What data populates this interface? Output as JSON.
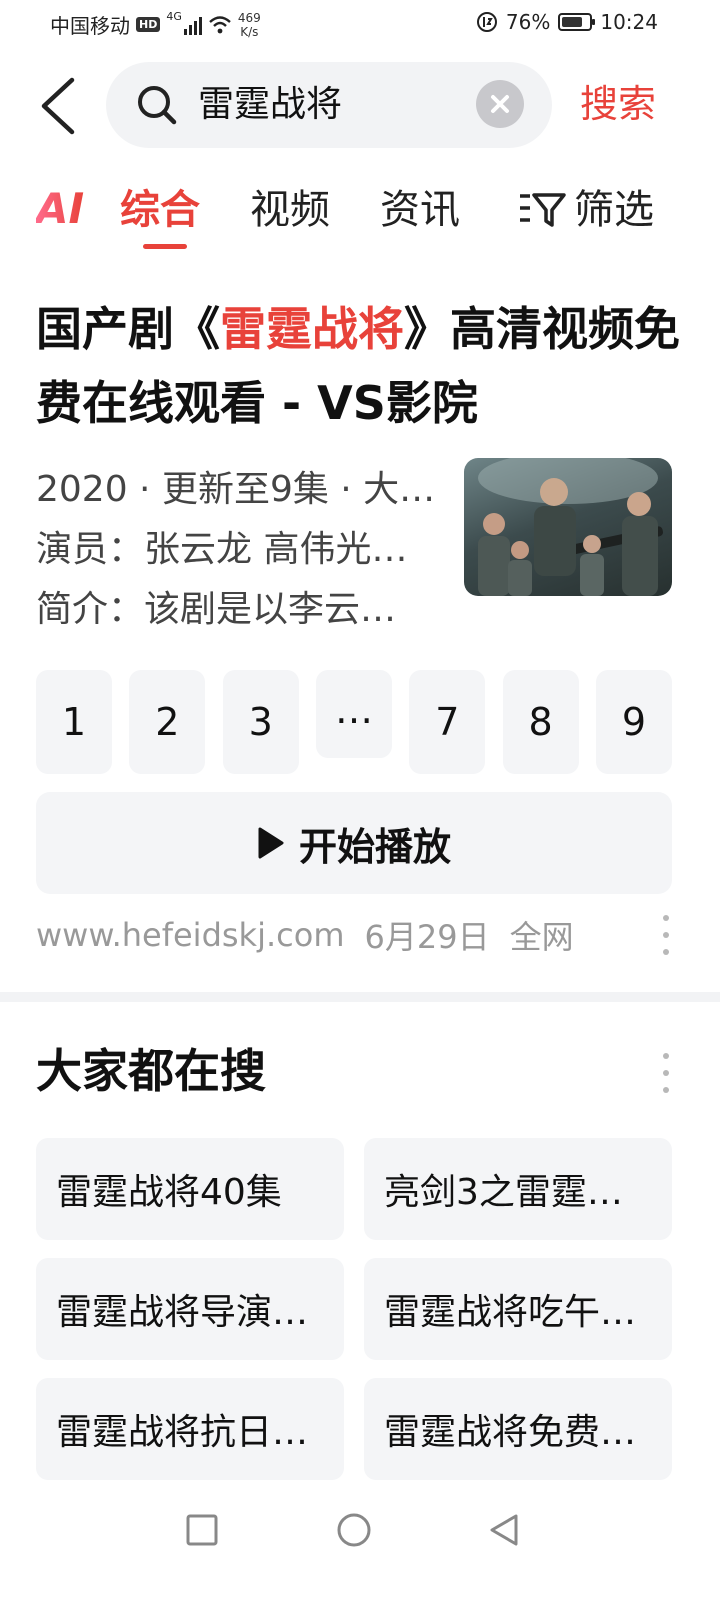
{
  "status_bar": {
    "carrier": "中国移动",
    "hd": "HD",
    "network": "4G",
    "net_speed_value": "469",
    "net_speed_unit": "K/s",
    "battery_percent": "76%",
    "battery_level": 0.76,
    "time": "10:24"
  },
  "search": {
    "query": "雷霆战将",
    "submit_label": "搜索"
  },
  "tabs": {
    "ai_label": "AI",
    "items": [
      "综合",
      "视频",
      "资讯"
    ],
    "active_index": 0,
    "filter_label": "筛选"
  },
  "result": {
    "title_prefix": "国产剧《",
    "title_highlight": "雷霆战将",
    "title_suffix": "》高清视频免费在线观看 - VS影院",
    "meta_line_1": "2020 · 更新至9集 · 大…",
    "meta_line_2": "演员：张云龙 高伟光…",
    "meta_line_3": "简介：该剧是以李云…",
    "episodes": [
      "1",
      "2",
      "3",
      "…",
      "7",
      "8",
      "9"
    ],
    "play_label": "开始播放",
    "source_url": "www.hefeidskj.com",
    "source_date": "6月29日",
    "source_scope": "全网"
  },
  "related": {
    "title": "大家都在搜",
    "items": [
      "雷霆战将40集",
      "亮剑3之雷霆…",
      "雷霆战将导演…",
      "雷霆战将吃午…",
      "雷霆战将抗日…",
      "雷霆战将免费…"
    ]
  },
  "colors": {
    "accent": "#e8423a",
    "card_bg": "#f4f5f7",
    "muted_text": "#999999"
  },
  "icons": {
    "back": "back-arrow-icon",
    "search": "search-icon",
    "clear": "clear-icon",
    "filter": "filter-icon",
    "play": "play-icon",
    "more": "more-vertical-icon",
    "nav_recent": "square-icon",
    "nav_home": "circle-icon",
    "nav_back": "triangle-back-icon"
  }
}
